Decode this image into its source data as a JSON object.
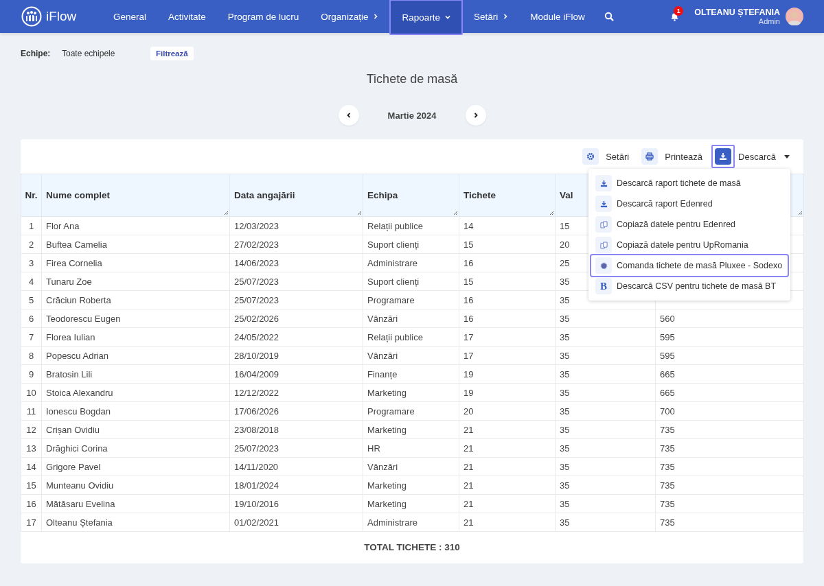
{
  "app": {
    "name": "iFlow"
  },
  "nav": [
    {
      "label": "General",
      "selected": false
    },
    {
      "label": "Activitate",
      "selected": false
    },
    {
      "label": "Program de lucru",
      "selected": false
    },
    {
      "label": "Organizație",
      "selected": false,
      "kind": "submenu"
    },
    {
      "label": "Rapoarte",
      "selected": true,
      "kind": "dropdown"
    },
    {
      "label": "Setări",
      "selected": false,
      "kind": "submenu"
    },
    {
      "label": "Module iFlow",
      "selected": false
    }
  ],
  "notifications": {
    "count": "1"
  },
  "user": {
    "name": "OLTEANU ȘTEFANIA",
    "role": "Admin"
  },
  "filter": {
    "label": "Echipe:",
    "value": "Toate echipele",
    "button": "Filtrează"
  },
  "title": "Tichete de masă",
  "period": "Martie 2024",
  "toolbar": [
    {
      "kind": "settings",
      "label": "Setări",
      "selected": false
    },
    {
      "kind": "print",
      "label": "Printează",
      "selected": false
    },
    {
      "kind": "download",
      "label": "Descarcă",
      "selected": true
    }
  ],
  "menu": [
    {
      "kind": "download",
      "label": "Descarcă raport tichete de masă",
      "selected": false
    },
    {
      "kind": "download",
      "label": "Descarcă raport Edenred",
      "selected": false
    },
    {
      "kind": "copy",
      "label": "Copiază datele pentru Edenred",
      "selected": false
    },
    {
      "kind": "copy",
      "label": "Copiază datele pentru UpRomania",
      "selected": false
    },
    {
      "kind": "flower",
      "label": "Comanda tichete de masă Pluxee - Sodexo",
      "selected": true
    },
    {
      "kind": "letter",
      "icon_text": "B",
      "label": "Descarcă CSV pentru tichete de masă BT",
      "selected": false
    }
  ],
  "table": {
    "columns": [
      "Nr.",
      "Nume complet",
      "Data angajării",
      "Echipa",
      "Tichete",
      "Val"
    ],
    "rows": [
      [
        "1",
        "Flor Ana",
        "12/03/2023",
        "Relații publice",
        "14",
        "15"
      ],
      [
        "2",
        "Buftea Camelia",
        "27/02/2023",
        "Suport clienți",
        "15",
        "20"
      ],
      [
        "3",
        "Firea Cornelia",
        "14/06/2023",
        "Administrare",
        "16",
        "25"
      ],
      [
        "4",
        "Tunaru Zoe",
        "25/07/2023",
        "Suport clienți",
        "15",
        "35"
      ],
      [
        "5",
        "Crăciun Roberta",
        "25/07/2023",
        "Programare",
        "16",
        "35"
      ],
      [
        "6",
        "Teodorescu Eugen",
        "25/02/2026",
        "Vânzări",
        "16",
        "35",
        "560"
      ],
      [
        "7",
        "Florea Iulian",
        "24/05/2022",
        "Relații publice",
        "17",
        "35",
        "595"
      ],
      [
        "8",
        "Popescu Adrian",
        "28/10/2019",
        "Vânzări",
        "17",
        "35",
        "595"
      ],
      [
        "9",
        "Bratosin Lili",
        "16/04/2009",
        "Finanțe",
        "19",
        "35",
        "665"
      ],
      [
        "10",
        "Stoica Alexandru",
        "12/12/2022",
        "Marketing",
        "19",
        "35",
        "665"
      ],
      [
        "11",
        "Ionescu Bogdan",
        "17/06/2026",
        "Programare",
        "20",
        "35",
        "700"
      ],
      [
        "12",
        "Crișan Ovidiu",
        "23/08/2018",
        "Marketing",
        "21",
        "35",
        "735"
      ],
      [
        "13",
        "Drăghici Corina",
        "25/07/2023",
        "HR",
        "21",
        "35",
        "735"
      ],
      [
        "14",
        "Grigore Pavel",
        "14/11/2020",
        "Vânzări",
        "21",
        "35",
        "735"
      ],
      [
        "15",
        "Munteanu Ovidiu",
        "18/01/2024",
        "Marketing",
        "21",
        "35",
        "735"
      ],
      [
        "16",
        "Mătăsaru Evelina",
        "19/10/2016",
        "Marketing",
        "21",
        "35",
        "735"
      ],
      [
        "17",
        "Olteanu Ștefania",
        "01/02/2021",
        "Administrare",
        "21",
        "35",
        "735"
      ]
    ],
    "total": "TOTAL TICHETE : 310"
  }
}
